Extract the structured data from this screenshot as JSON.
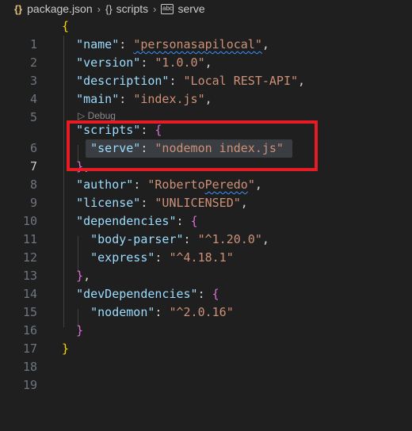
{
  "breadcrumb": {
    "file_icon": "{}",
    "file": "package.json",
    "section_icon": "{}",
    "section": "scripts",
    "leaf": "serve",
    "leaf_icon": "abc"
  },
  "codelens": {
    "label": "Debug"
  },
  "lines": [
    {
      "n": "1"
    },
    {
      "n": "2"
    },
    {
      "n": "3"
    },
    {
      "n": "4"
    },
    {
      "n": "5"
    },
    {
      "n": "6"
    },
    {
      "n": "7"
    },
    {
      "n": "8"
    },
    {
      "n": "9"
    },
    {
      "n": "10"
    },
    {
      "n": "11"
    },
    {
      "n": "12"
    },
    {
      "n": "13"
    },
    {
      "n": "14"
    },
    {
      "n": "15"
    },
    {
      "n": "16"
    },
    {
      "n": "17"
    },
    {
      "n": "18"
    },
    {
      "n": "19"
    }
  ],
  "code": {
    "name_key": "\"name\"",
    "name_val": "\"personasapilocal\"",
    "version_key": "\"version\"",
    "version_val": "\"1.0.0\"",
    "description_key": "\"description\"",
    "description_val": "\"Local REST-API\"",
    "main_key": "\"main\"",
    "main_val": "\"index.js\"",
    "scripts_key": "\"scripts\"",
    "serve_key": "\"serve\"",
    "serve_val": "\"nodemon index.js\"",
    "author_key": "\"author\"",
    "author_val_a": "\"Roberto",
    "author_val_b": "Peredo",
    "author_val_c": "\"",
    "license_key": "\"license\"",
    "license_val": "\"UNLICENSED\"",
    "dependencies_key": "\"dependencies\"",
    "bodyparser_key": "\"body-parser\"",
    "bodyparser_val": "\"^1.20.0\"",
    "express_key": "\"express\"",
    "express_val": "\"^4.18.1\"",
    "devdependencies_key": "\"devDependencies\"",
    "nodemon_key": "\"nodemon\"",
    "nodemon_val": "\"^2.0.16\""
  },
  "colors": {
    "background": "#1f1f1f",
    "key": "#9cdcfe",
    "string": "#ce9178",
    "highlight_box": "#e51c23"
  }
}
